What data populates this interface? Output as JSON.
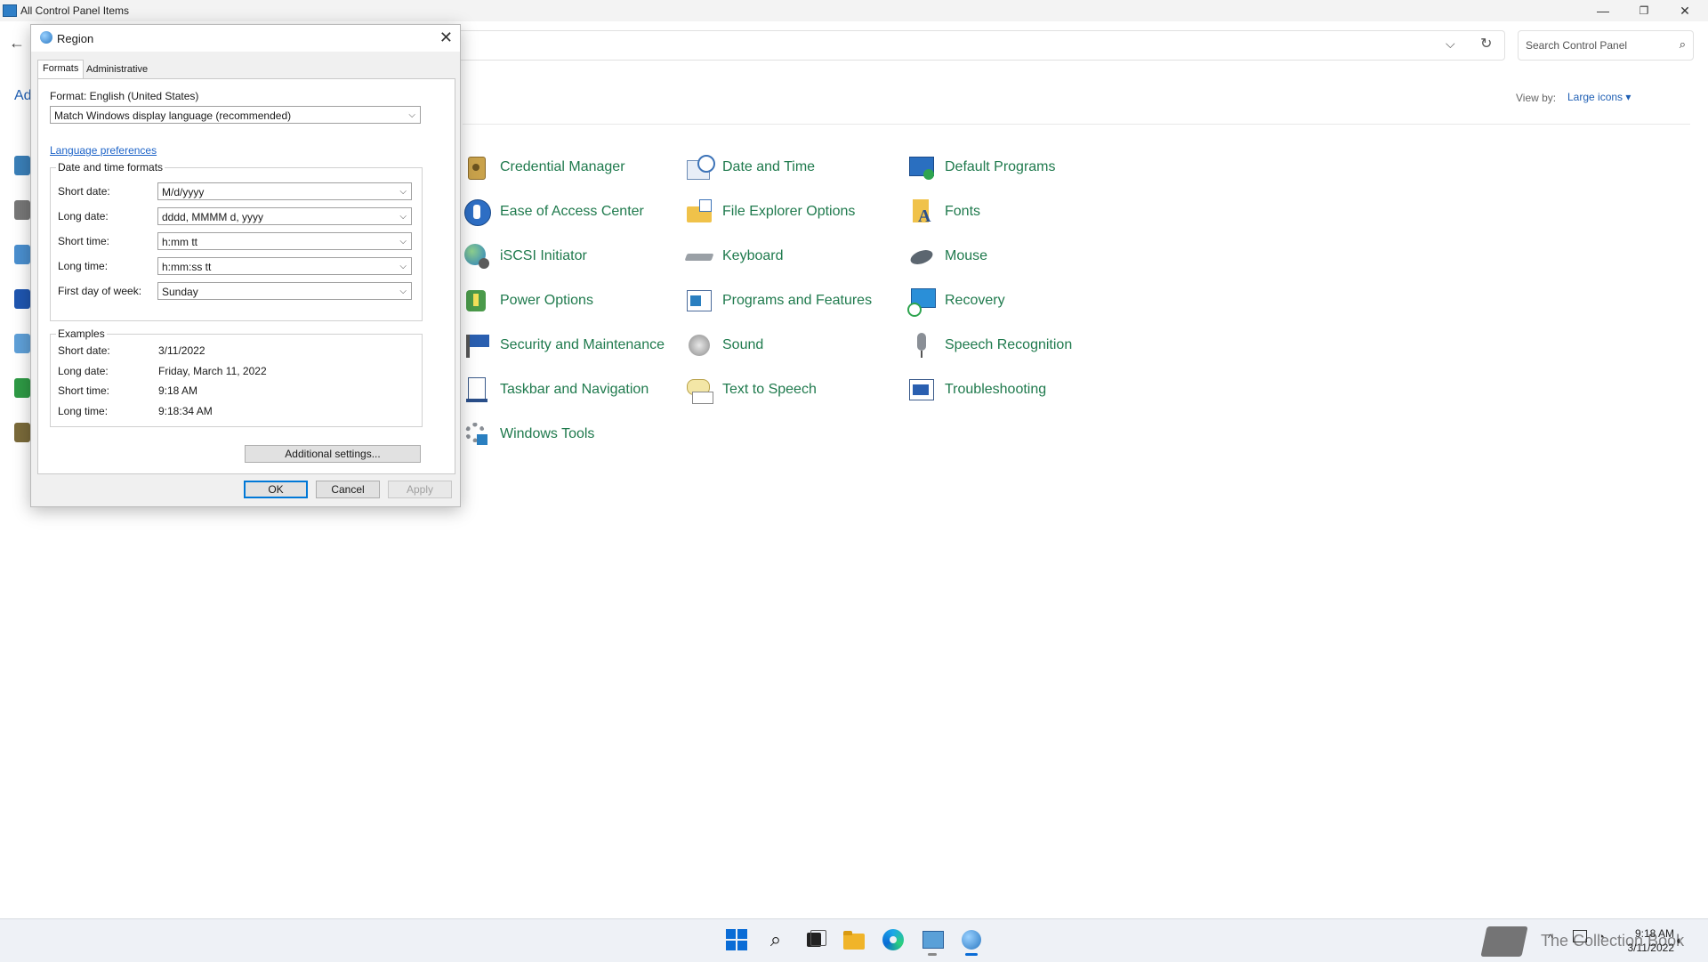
{
  "window": {
    "title": "All Control Panel Items",
    "search_placeholder": "Search Control Panel",
    "left_fragment": "Ad",
    "view_by_label": "View by:",
    "view_by_value": "Large icons ▾"
  },
  "items": [
    {
      "label": "Credential Manager",
      "icon": "credential-manager-icon"
    },
    {
      "label": "Date and Time",
      "icon": "date-time-icon"
    },
    {
      "label": "Default Programs",
      "icon": "default-programs-icon"
    },
    {
      "label": "Ease of Access Center",
      "icon": "ease-of-access-icon"
    },
    {
      "label": "File Explorer Options",
      "icon": "file-explorer-options-icon"
    },
    {
      "label": "Fonts",
      "icon": "fonts-icon"
    },
    {
      "label": "iSCSI Initiator",
      "icon": "iscsi-initiator-icon"
    },
    {
      "label": "Keyboard",
      "icon": "keyboard-icon"
    },
    {
      "label": "Mouse",
      "icon": "mouse-icon"
    },
    {
      "label": "Power Options",
      "icon": "power-options-icon"
    },
    {
      "label": "Programs and Features",
      "icon": "programs-features-icon"
    },
    {
      "label": "Recovery",
      "icon": "recovery-icon"
    },
    {
      "label": "Security and Maintenance",
      "icon": "security-maintenance-icon"
    },
    {
      "label": "Sound",
      "icon": "sound-icon"
    },
    {
      "label": "Speech Recognition",
      "icon": "speech-recognition-icon"
    },
    {
      "label": "Taskbar and Navigation",
      "icon": "taskbar-navigation-icon"
    },
    {
      "label": "Text to Speech",
      "icon": "text-to-speech-icon"
    },
    {
      "label": "Troubleshooting",
      "icon": "troubleshooting-icon"
    },
    {
      "label": "Windows Tools",
      "icon": "windows-tools-icon"
    }
  ],
  "dialog": {
    "title": "Region",
    "tabs": [
      "Formats",
      "Administrative"
    ],
    "format_label": "Format: English (United States)",
    "format_value": "Match Windows display language (recommended)",
    "language_link": "Language preferences",
    "dt_group_title": "Date and time formats",
    "fields": [
      {
        "label": "Short date:",
        "value": "M/d/yyyy"
      },
      {
        "label": "Long date:",
        "value": "dddd, MMMM d, yyyy"
      },
      {
        "label": "Short time:",
        "value": "h:mm tt"
      },
      {
        "label": "Long time:",
        "value": "h:mm:ss tt"
      },
      {
        "label": "First day of week:",
        "value": "Sunday"
      }
    ],
    "examples_title": "Examples",
    "examples": [
      {
        "label": "Short date:",
        "value": "3/11/2022"
      },
      {
        "label": "Long date:",
        "value": "Friday, March 11, 2022"
      },
      {
        "label": "Short time:",
        "value": "9:18 AM"
      },
      {
        "label": "Long time:",
        "value": "9:18:34 AM"
      }
    ],
    "additional_settings": "Additional settings...",
    "ok": "OK",
    "cancel": "Cancel",
    "apply": "Apply"
  },
  "taskbar": {
    "time": "9:18 AM",
    "date": "3/11/2022",
    "watermark": "The Collection Book"
  },
  "colors": {
    "item_label": "#1f7a4d",
    "link": "#1e64c8",
    "default_button_border": "#0078d7"
  }
}
